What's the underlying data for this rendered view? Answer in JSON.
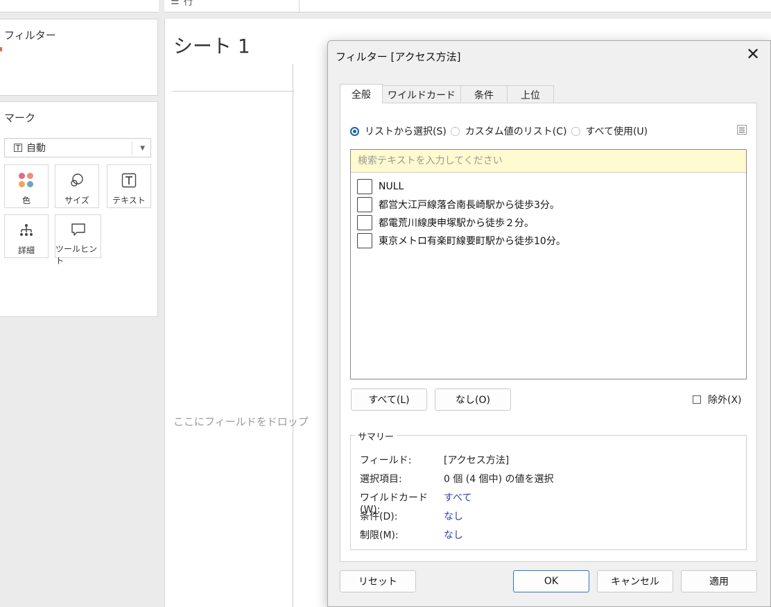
{
  "background": {
    "rows_shelf_label": "行",
    "filters_panel_title": "フィルター",
    "marks_panel_title": "マーク",
    "mark_type": "自動",
    "mark_buttons": [
      {
        "label": "色",
        "icon": "color-dots-icon"
      },
      {
        "label": "サイズ",
        "icon": "size-circles-icon"
      },
      {
        "label": "テキスト",
        "icon": "text-t-icon"
      },
      {
        "label": "詳細",
        "icon": "detail-tree-icon"
      },
      {
        "label": "ツールヒント",
        "icon": "speech-bubble-icon"
      }
    ],
    "sheet_title": "シート 1",
    "drop_hint": "ここにフィールドをドロップ"
  },
  "dialog": {
    "title": "フィルター [アクセス方法]",
    "close_glyph": "✕",
    "tabs": [
      {
        "label": "全般",
        "active": true
      },
      {
        "label": "ワイルドカード",
        "active": false
      },
      {
        "label": "条件",
        "active": false
      },
      {
        "label": "上位",
        "active": false
      }
    ],
    "radio_options": [
      {
        "label": "リストから選択(S)",
        "checked": true
      },
      {
        "label": "カスタム値のリスト(C)",
        "checked": false
      },
      {
        "label": "すべて使用(U)",
        "checked": false
      }
    ],
    "search_placeholder": "検索テキストを入力してください",
    "values": [
      {
        "label": "NULL",
        "checked": false
      },
      {
        "label": "都営大江戸線落合南長崎駅から徒歩3分。",
        "checked": false
      },
      {
        "label": "都電荒川線庚申塚駅から徒歩２分。",
        "checked": false
      },
      {
        "label": "東京メトロ有楽町線要町駅から徒歩10分。",
        "checked": false
      }
    ],
    "all_button": "すべて(L)",
    "none_button": "なし(O)",
    "exclude_label": "除外(X)",
    "summary": {
      "legend": "サマリー",
      "rows": [
        {
          "key": "フィールド:",
          "value": "[アクセス方法]",
          "link": false
        },
        {
          "key": "選択項目:",
          "value": "0 個 (4 個中) の値を選択",
          "link": false
        },
        {
          "key": "ワイルドカード(W):",
          "value": "すべて",
          "link": true
        },
        {
          "key": "条件(D):",
          "value": "なし",
          "link": true
        },
        {
          "key": "制限(M):",
          "value": "なし",
          "link": true
        }
      ]
    },
    "buttons": {
      "reset": "リセット",
      "ok": "OK",
      "cancel": "キャンセル",
      "apply": "適用"
    }
  },
  "colors": {
    "accent_blue": "#1a5fb4",
    "link_blue": "#2a3fb0",
    "search_bg": "#fffad0"
  }
}
